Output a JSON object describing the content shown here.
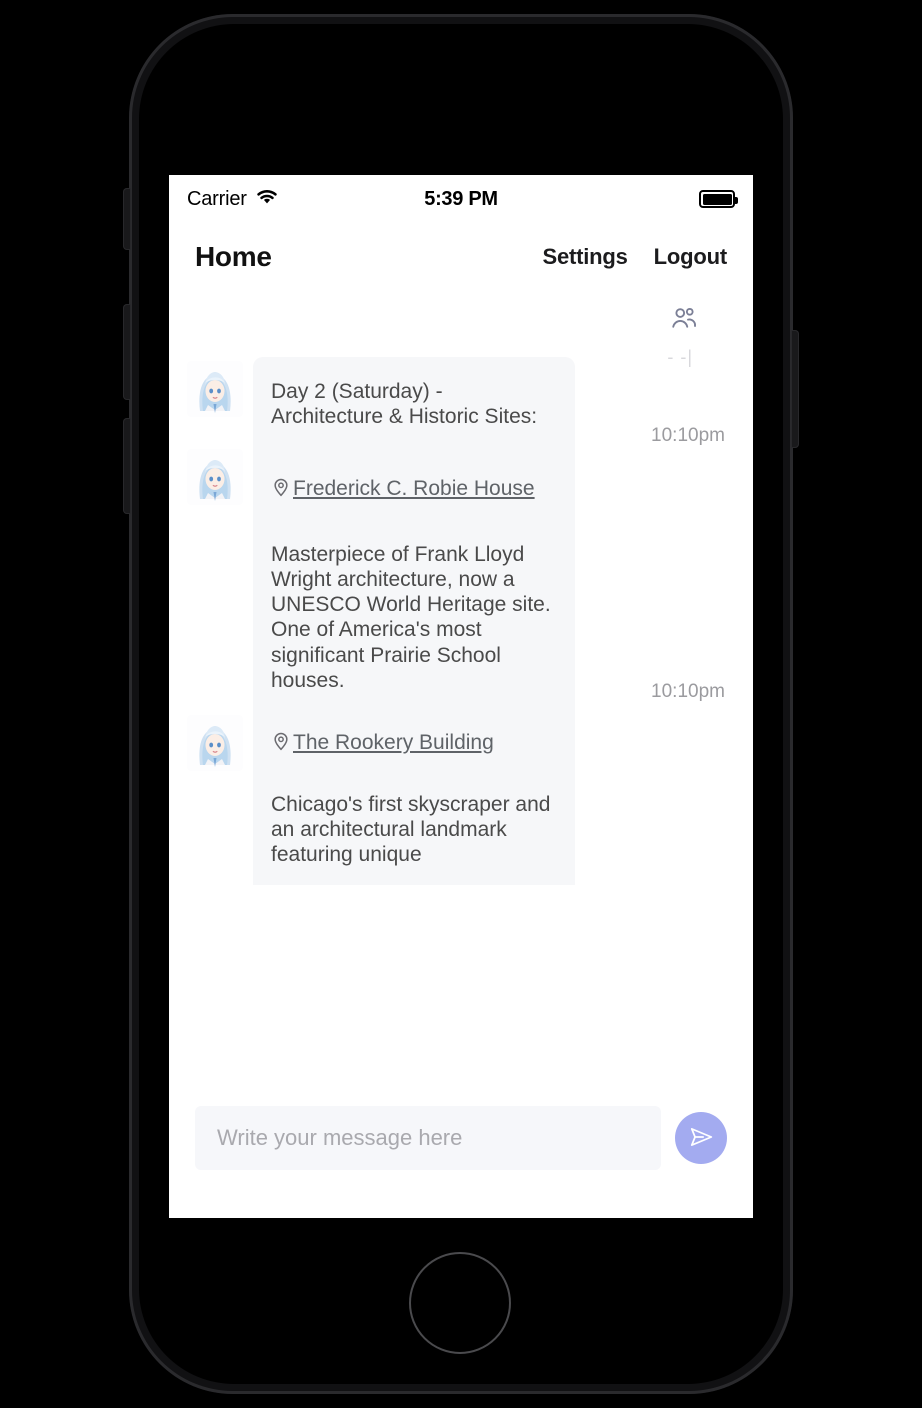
{
  "status_bar": {
    "carrier": "Carrier",
    "time": "5:39 PM",
    "wifi_icon": "wifi-icon",
    "battery_icon": "battery-full-icon"
  },
  "nav_header": {
    "title": "Home",
    "settings_label": "Settings",
    "logout_label": "Logout"
  },
  "chat_toolbar": {
    "group_icon": "group-members-icon"
  },
  "conversation": {
    "scroll_ghost_text": "- -|",
    "messages": [
      {
        "id": "msg-day2-heading",
        "avatar": "user-avatar",
        "text": "Day 2 (Saturday) - Architecture & Historic Sites:",
        "time": "10:10pm"
      },
      {
        "id": "msg-robie-house",
        "avatar": "user-avatar",
        "place_icon": "location-pin-icon",
        "place_name": "Frederick C. Robie House",
        "text": "Masterpiece of Frank Lloyd Wright architecture, now a UNESCO World Heritage site. One of America's most significant Prairie School houses.",
        "time": "10:10pm"
      },
      {
        "id": "msg-rookery-building",
        "avatar": "user-avatar",
        "place_icon": "location-pin-icon",
        "place_name": "The Rookery Building",
        "text": "Chicago's first skyscraper and an architectural landmark featuring unique",
        "time": ""
      }
    ]
  },
  "composer": {
    "placeholder": "Write your message here",
    "value": "",
    "send_icon": "send-paper-plane-icon",
    "send_button_color": "#a3abf0"
  },
  "colors": {
    "bubble_background": "#f6f7f9",
    "bubble_text": "#4a4a4a",
    "timestamp": "#9b9b9f",
    "accent": "#a3abf0",
    "screen_background": "#ffffff",
    "phone_body": "#111113"
  },
  "device": {
    "home_button": "home-button",
    "side_buttons": [
      "silent-switch",
      "volume-up-button",
      "volume-down-button",
      "power-button"
    ]
  }
}
